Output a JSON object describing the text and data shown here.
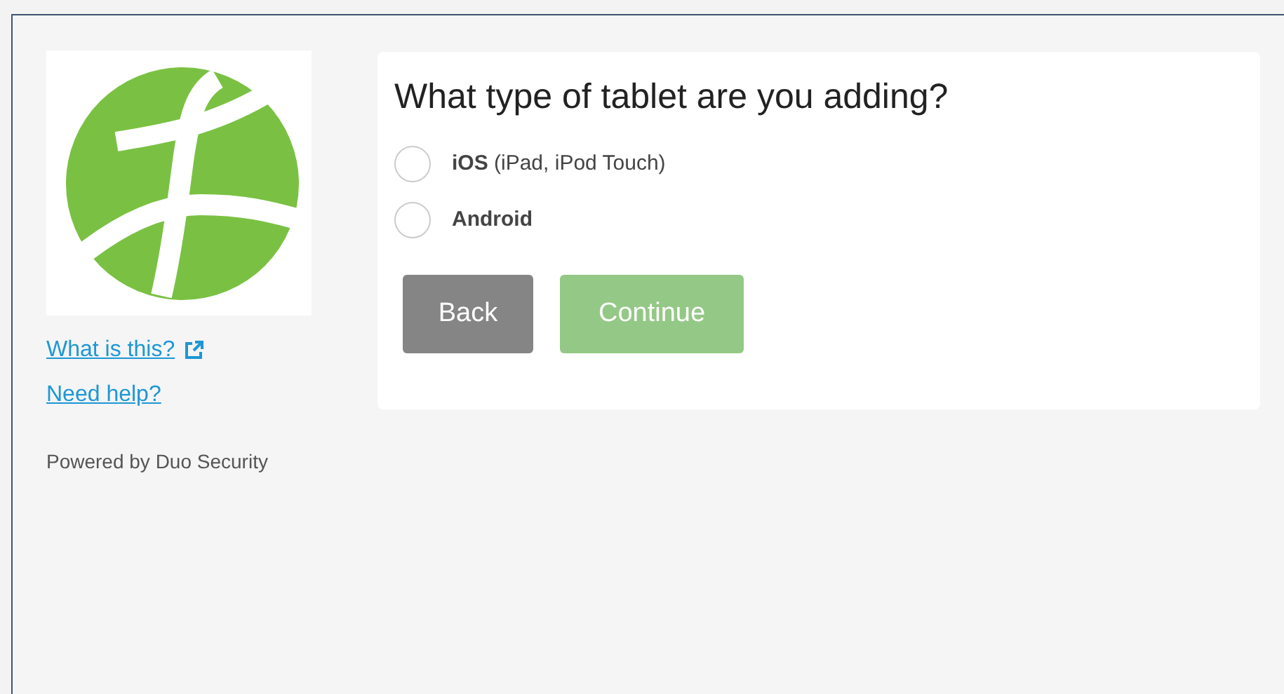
{
  "sidebar": {
    "links": [
      {
        "label": "What is this?",
        "external": true
      },
      {
        "label": "Need help?",
        "external": false
      }
    ],
    "powered_by": "Powered by Duo Security"
  },
  "prompt": {
    "title": "What type of tablet are you adding?",
    "options": [
      {
        "name": "iOS",
        "detail": "(iPad, iPod Touch)",
        "selected": false
      },
      {
        "name": "Android",
        "selected": false
      }
    ],
    "buttons": [
      {
        "label": "Back",
        "kind": "secondary",
        "disabled": false
      },
      {
        "label": "Continue",
        "kind": "primary",
        "disabled": true
      }
    ]
  }
}
